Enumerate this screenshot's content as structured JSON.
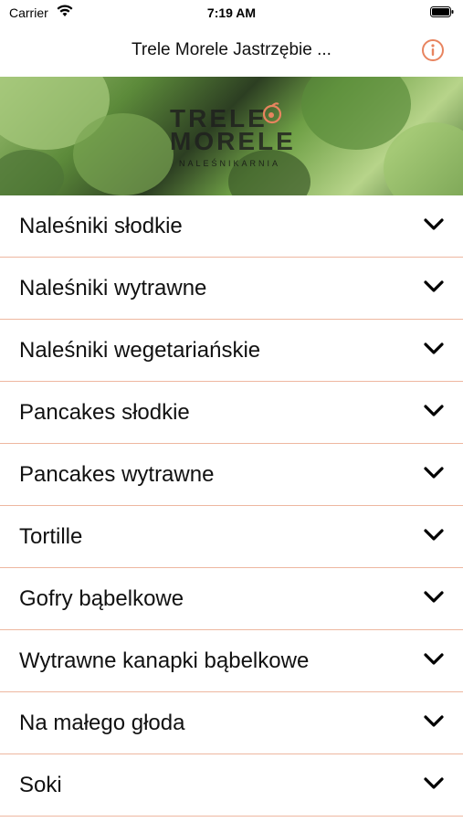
{
  "status_bar": {
    "carrier": "Carrier",
    "time": "7:19 AM"
  },
  "nav": {
    "title": "Trele Morele Jastrzębie ...",
    "info_icon": "info-icon",
    "accent_color": "#e8845f"
  },
  "hero": {
    "logo_line1": "TRELE",
    "logo_line2": "MORELE",
    "logo_sub": "NALEŚNIKARNIA"
  },
  "menu": {
    "chevron_icon": "chevron-down-icon",
    "divider_color": "#eeb7a0",
    "items": [
      {
        "label": "Naleśniki słodkie"
      },
      {
        "label": "Naleśniki wytrawne"
      },
      {
        "label": "Naleśniki wegetariańskie"
      },
      {
        "label": "Pancakes słodkie"
      },
      {
        "label": "Pancakes wytrawne"
      },
      {
        "label": "Tortille"
      },
      {
        "label": "Gofry bąbelkowe"
      },
      {
        "label": "Wytrawne kanapki bąbelkowe"
      },
      {
        "label": "Na małego głoda"
      },
      {
        "label": "Soki"
      }
    ]
  }
}
